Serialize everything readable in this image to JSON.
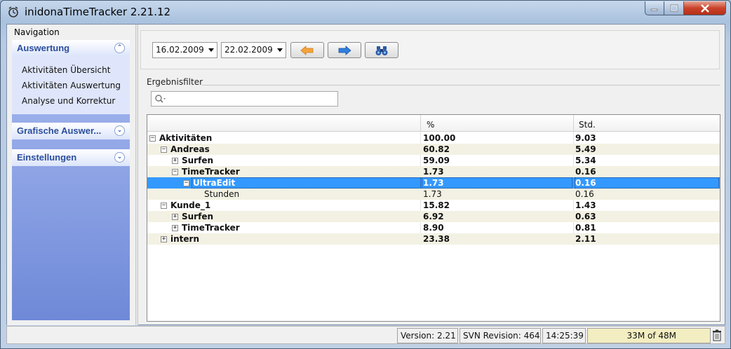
{
  "window": {
    "title": "inidonaTimeTracker 2.21.12"
  },
  "navigation": {
    "title": "Navigation",
    "groups": [
      {
        "label": "Auswertung",
        "expanded": true,
        "items": [
          "Aktivitäten Übersicht",
          "Aktivitäten Auswertung",
          "Analyse und Korrektur"
        ]
      },
      {
        "label": "Grafische Auswer...",
        "expanded": false
      },
      {
        "label": "Einstellungen",
        "expanded": false
      }
    ]
  },
  "toolbar": {
    "date_from": "16.02.2009",
    "date_to": "22.02.2009",
    "back_icon": "arrow-left-icon",
    "forward_icon": "arrow-right-icon",
    "search_icon": "binoculars-icon"
  },
  "filter": {
    "label": "Ergebnisfilter",
    "search_placeholder": ""
  },
  "grid": {
    "columns": [
      "",
      "%",
      "Std."
    ],
    "rows": [
      {
        "label": "Aktivitäten",
        "percent": "100.00",
        "hours": "9.03",
        "level": 0,
        "toggle": "minus",
        "bold": true
      },
      {
        "label": "Andreas",
        "percent": "60.82",
        "hours": "5.49",
        "level": 1,
        "toggle": "minus",
        "bold": true
      },
      {
        "label": "Surfen",
        "percent": "59.09",
        "hours": "5.34",
        "level": 2,
        "toggle": "plus",
        "bold": true
      },
      {
        "label": "TimeTracker",
        "percent": "1.73",
        "hours": "0.16",
        "level": 2,
        "toggle": "minus",
        "bold": true
      },
      {
        "label": "UltraEdit",
        "percent": "1.73",
        "hours": "0.16",
        "level": 3,
        "toggle": "minus",
        "bold": true,
        "selected": true
      },
      {
        "label": "Stunden",
        "percent": "1.73",
        "hours": "0.16",
        "level": 4,
        "toggle": "none",
        "bold": false
      },
      {
        "label": "Kunde_1",
        "percent": "15.82",
        "hours": "1.43",
        "level": 1,
        "toggle": "minus",
        "bold": true
      },
      {
        "label": "Surfen",
        "percent": "6.92",
        "hours": "0.63",
        "level": 2,
        "toggle": "plus",
        "bold": true
      },
      {
        "label": "TimeTracker",
        "percent": "8.90",
        "hours": "0.81",
        "level": 2,
        "toggle": "plus",
        "bold": true
      },
      {
        "label": "intern",
        "percent": "23.38",
        "hours": "2.11",
        "level": 1,
        "toggle": "plus",
        "bold": true
      }
    ]
  },
  "status": {
    "version": "Version: 2.21",
    "svn": "SVN Revision: 464",
    "time": "14:25:39",
    "memory": "33M of 48M",
    "memory_used_fraction": 0.6875,
    "trash_icon": "trash-icon"
  },
  "colors": {
    "nav_gradient_top": "#a8bbf0",
    "nav_gradient_bottom": "#6f89d8",
    "selection": "#3399ff",
    "alt_row": "#f3f1e3"
  }
}
